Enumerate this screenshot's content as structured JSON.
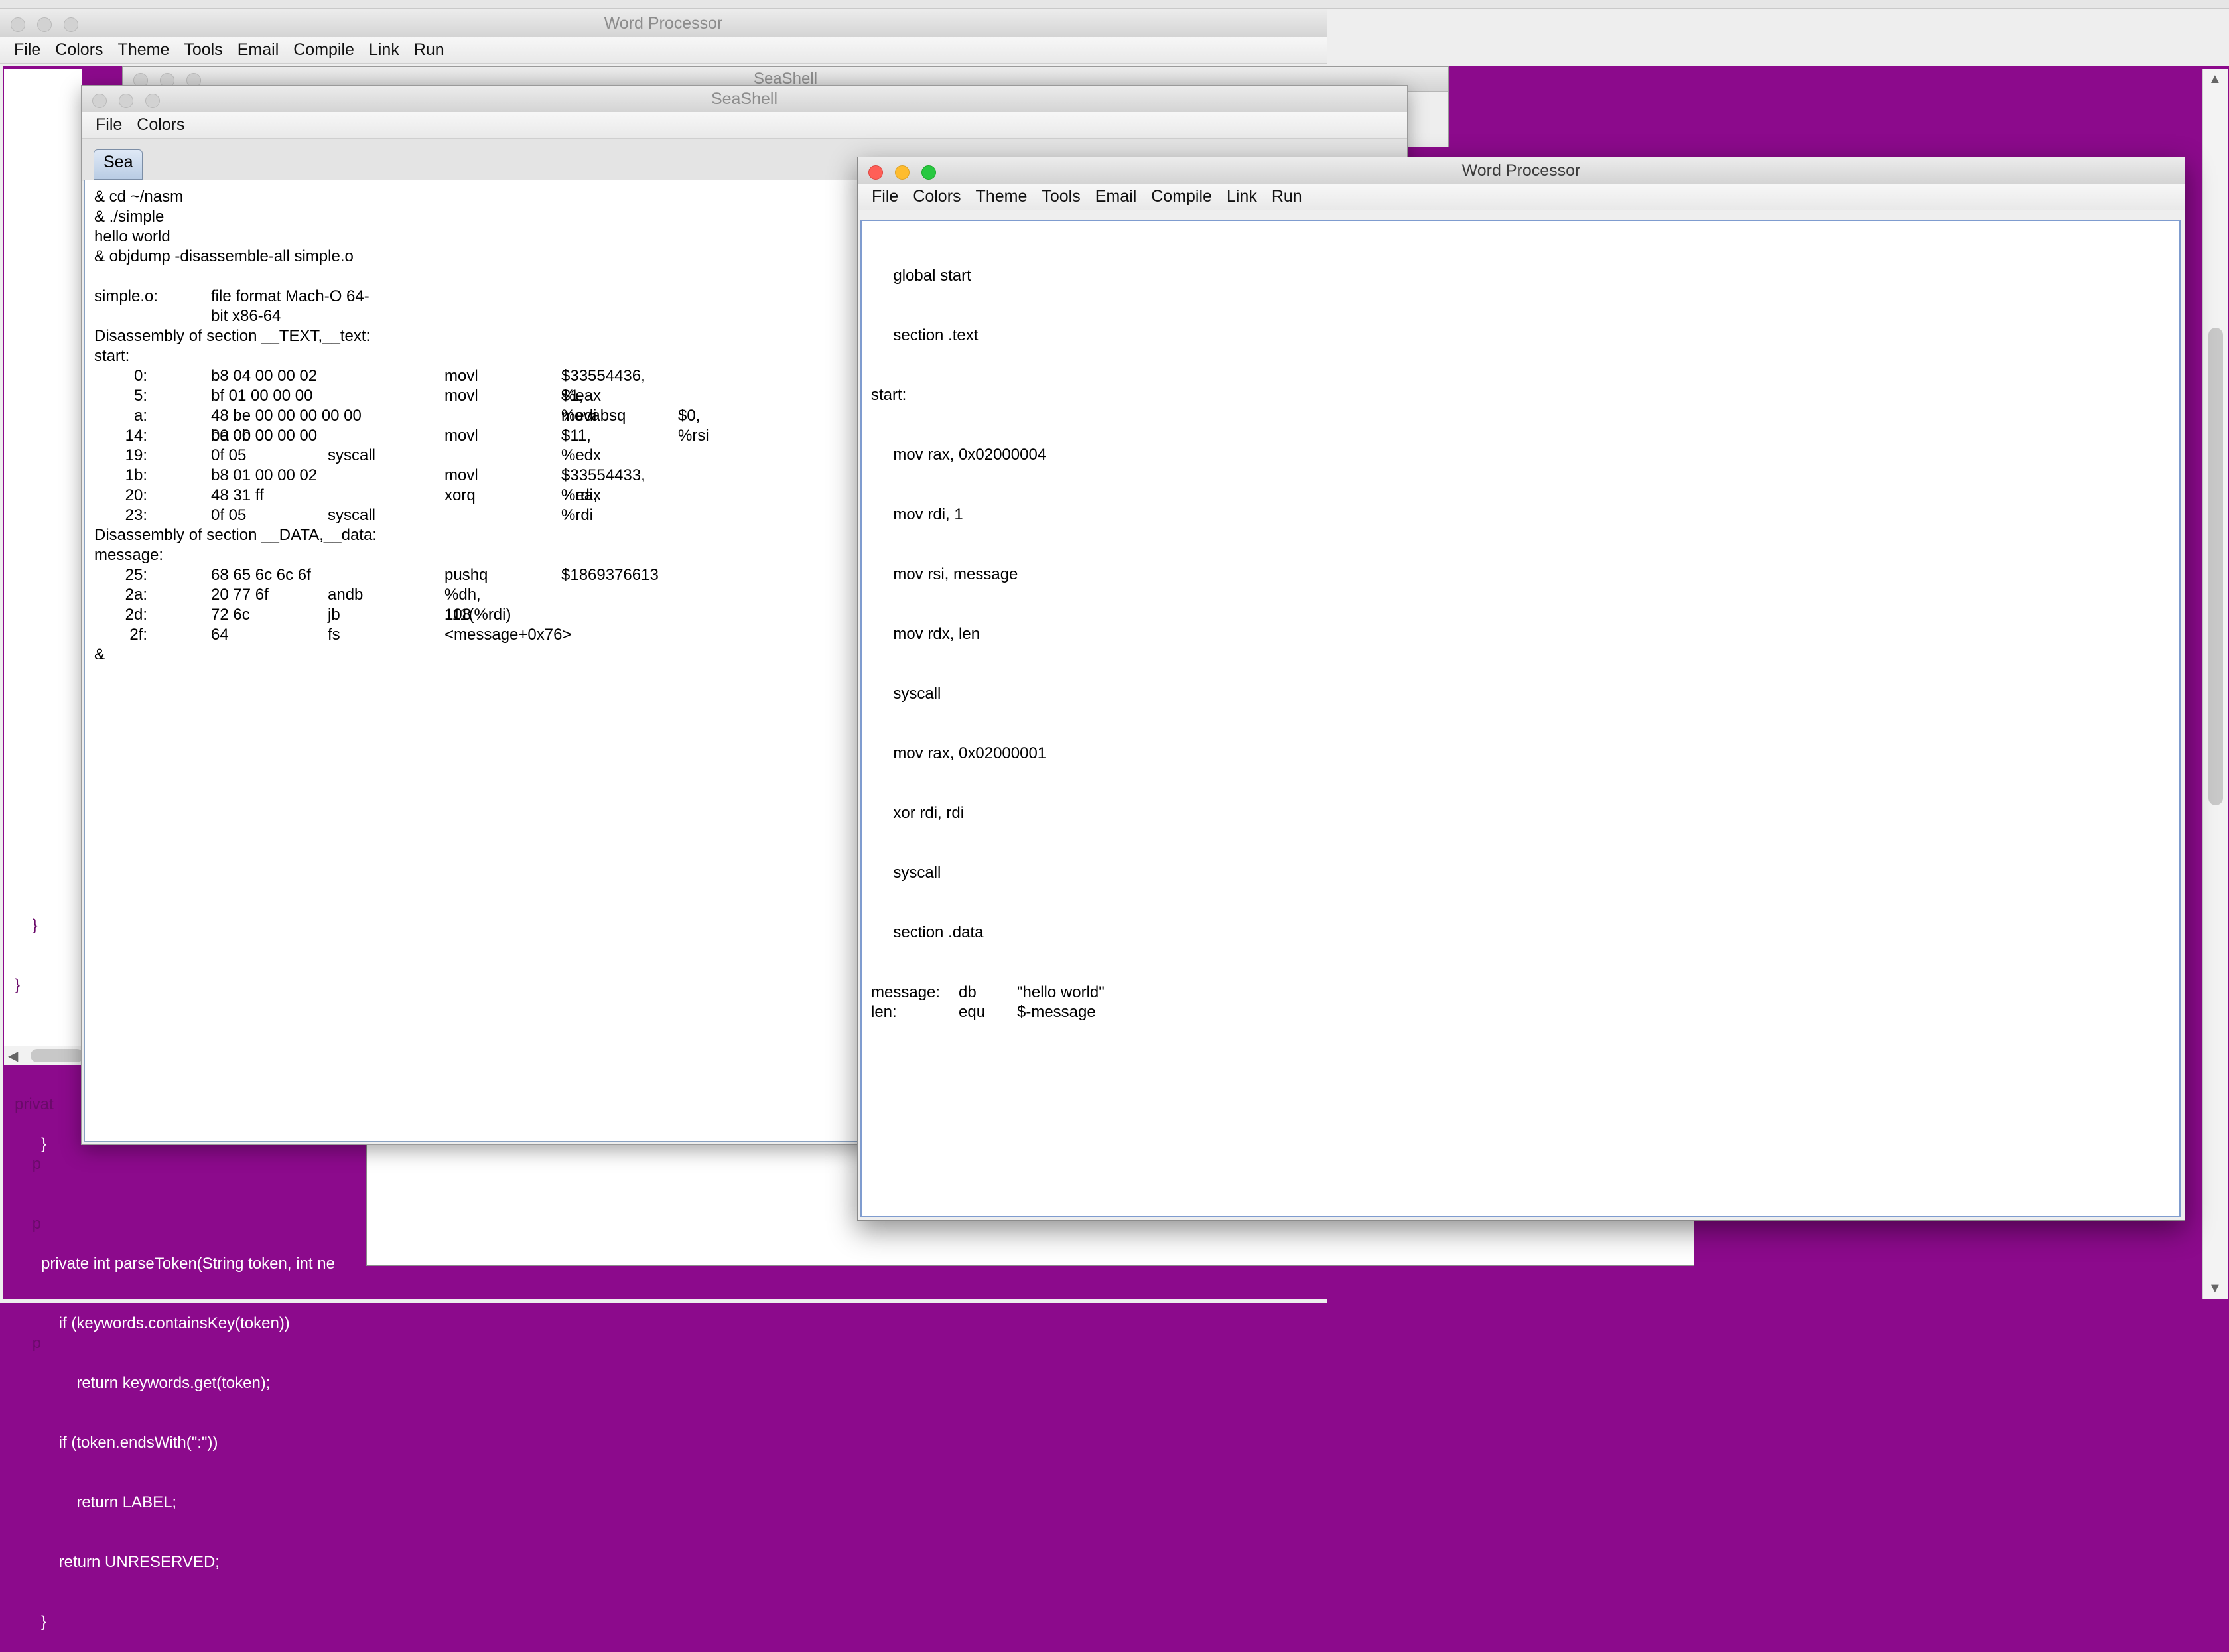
{
  "bg_window": {
    "title": "Word Processor",
    "menu": [
      "File",
      "Colors",
      "Theme",
      "Tools",
      "Email",
      "Compile",
      "Link",
      "Run"
    ],
    "code_visible": [
      "    }",
      "}",
      "",
      "privat",
      "    p",
      "    p",
      "",
      "    p"
    ],
    "code_purple": [
      "}",
      "",
      "private int parseToken(String token, int ne",
      "    if (keywords.containsKey(token))",
      "        return keywords.get(token);",
      "    if (token.endsWith(\":\"))",
      "        return LABEL;",
      "    return UNRESERVED;",
      "}"
    ]
  },
  "seashell_back": {
    "title": "SeaShell"
  },
  "seashell": {
    "title": "SeaShell",
    "menu": [
      "File",
      "Colors"
    ],
    "tab": "Sea",
    "lines": [
      "& cd ~/nasm",
      "& ./simple",
      "hello world",
      "& objdump -disassemble-all simple.o",
      "",
      "simple.o:\tfile format Mach-O 64-bit x86-64",
      "",
      "Disassembly of section __TEXT,__text:",
      "start:"
    ],
    "text_rows": [
      [
        "0:",
        "b8 04 00 00 02",
        "movl",
        "$33554436, %eax"
      ],
      [
        "5:",
        "bf 01 00 00 00",
        "movl",
        "$1, %edi"
      ],
      [
        "a:",
        "48 be 00 00 00 00 00 00 00 00",
        "movabsq",
        "$0, %rsi"
      ],
      [
        "14:",
        "ba 0b 00 00 00",
        "movl",
        "$11, %edx"
      ],
      [
        "19:",
        "0f 05",
        "syscall",
        ""
      ],
      [
        "1b:",
        "b8 01 00 00 02",
        "movl",
        "$33554433, %eax"
      ],
      [
        "20:",
        "48 31 ff",
        "xorq",
        "%rdi, %rdi"
      ],
      [
        "23:",
        "0f 05",
        "syscall",
        ""
      ]
    ],
    "data_header": "Disassembly of section __DATA,__data:",
    "data_label": "message:",
    "data_rows": [
      [
        "25:",
        "68 65 6c 6c 6f",
        "pushq",
        "$1869376613"
      ],
      [
        "2a:",
        "20 77 6f",
        "andb",
        "%dh, 111(%rdi)"
      ],
      [
        "2d:",
        "72 6c",
        "jb",
        "108 <message+0x76>"
      ],
      [
        "2f:",
        "64",
        "fs",
        ""
      ]
    ],
    "prompt": "&"
  },
  "word_processor": {
    "title": "Word Processor",
    "menu": [
      "File",
      "Colors",
      "Theme",
      "Tools",
      "Email",
      "Compile",
      "Link",
      "Run"
    ],
    "lines": [
      "     global start",
      "     section .text",
      "start:",
      "     mov rax, 0x02000004",
      "     mov rdi, 1",
      "     mov rsi, message",
      "     mov rdx, len",
      "     syscall",
      "     mov rax, 0x02000001",
      "     xor rdi, rdi",
      "     syscall",
      "     section .data"
    ],
    "data_rows": [
      [
        "message:",
        "db",
        "\"hello world\""
      ],
      [
        "len:",
        "equ",
        "$-message"
      ]
    ]
  }
}
